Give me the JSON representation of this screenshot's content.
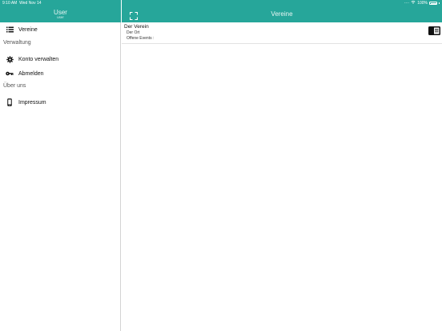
{
  "status_bar": {
    "time": "9:10 AM",
    "date": "Wed Nov 14",
    "battery": "100%"
  },
  "sidebar": {
    "user_name": "User",
    "user_sub": "user",
    "items": [
      {
        "label": "Vereine",
        "icon": "list-icon"
      },
      {
        "label": "Konto verwalten",
        "icon": "gear-icon"
      },
      {
        "label": "Abmelden",
        "icon": "key-icon"
      },
      {
        "label": "Impressum",
        "icon": "phone-icon"
      }
    ],
    "sections": {
      "admin": "Verwaltung",
      "about": "Über uns"
    }
  },
  "main": {
    "title": "Vereine",
    "clubs": [
      {
        "name": "Der Verein",
        "place": "Der Ort",
        "events": "Offene Events :"
      }
    ]
  },
  "colors": {
    "header": "#26a69a",
    "header_text": "#e8f6f4",
    "divider": "#d4d4d4"
  }
}
